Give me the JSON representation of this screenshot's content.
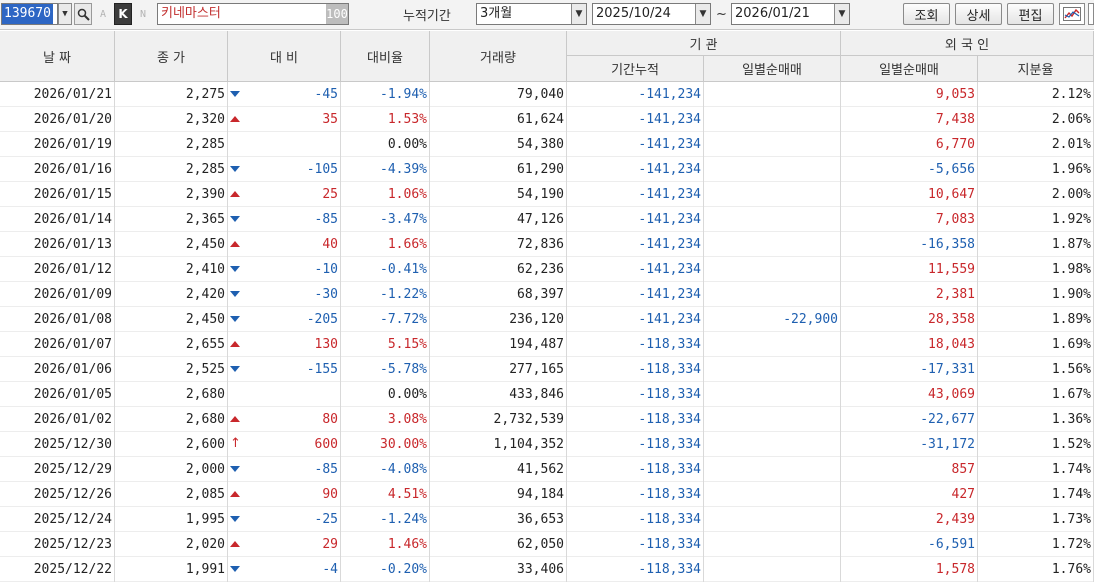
{
  "toolbar": {
    "stock_code": "139670",
    "a_label": "A",
    "k_label": "K",
    "n_label": "N",
    "stock_name": "키네마스터",
    "name_badge": "100",
    "period_label": "누적기간",
    "period_value": "3개월",
    "start_date": "2025/10/24",
    "tilde": "~",
    "end_date": "2026/01/21",
    "search_btn": "조회",
    "detail_btn": "상세",
    "edit_btn": "편집"
  },
  "headers": {
    "date": "날 짜",
    "close": "종 가",
    "change": "대 비",
    "change_rate": "대비율",
    "volume": "거래량",
    "institution": "기  관",
    "inst_cum": "기간누적",
    "inst_daily": "일별순매매",
    "foreign": "외 국 인",
    "for_daily": "일별순매매",
    "for_share": "지분율"
  },
  "rows": [
    {
      "date": "2026/01/21",
      "close": "2,275",
      "dir": "dn",
      "change": "-45",
      "rate": "-1.94%",
      "volume": "79,040",
      "inst_cum": "-141,234",
      "inst_daily": "",
      "for_daily": "9,053",
      "for_share": "2.12%"
    },
    {
      "date": "2026/01/20",
      "close": "2,320",
      "dir": "up",
      "change": "35",
      "rate": "1.53%",
      "volume": "61,624",
      "inst_cum": "-141,234",
      "inst_daily": "",
      "for_daily": "7,438",
      "for_share": "2.06%"
    },
    {
      "date": "2026/01/19",
      "close": "2,285",
      "dir": "nu",
      "change": "",
      "rate": "0.00%",
      "volume": "54,380",
      "inst_cum": "-141,234",
      "inst_daily": "",
      "for_daily": "6,770",
      "for_share": "2.01%"
    },
    {
      "date": "2026/01/16",
      "close": "2,285",
      "dir": "dn",
      "change": "-105",
      "rate": "-4.39%",
      "volume": "61,290",
      "inst_cum": "-141,234",
      "inst_daily": "",
      "for_daily": "-5,656",
      "for_share": "1.96%"
    },
    {
      "date": "2026/01/15",
      "close": "2,390",
      "dir": "up",
      "change": "25",
      "rate": "1.06%",
      "volume": "54,190",
      "inst_cum": "-141,234",
      "inst_daily": "",
      "for_daily": "10,647",
      "for_share": "2.00%"
    },
    {
      "date": "2026/01/14",
      "close": "2,365",
      "dir": "dn",
      "change": "-85",
      "rate": "-3.47%",
      "volume": "47,126",
      "inst_cum": "-141,234",
      "inst_daily": "",
      "for_daily": "7,083",
      "for_share": "1.92%"
    },
    {
      "date": "2026/01/13",
      "close": "2,450",
      "dir": "up",
      "change": "40",
      "rate": "1.66%",
      "volume": "72,836",
      "inst_cum": "-141,234",
      "inst_daily": "",
      "for_daily": "-16,358",
      "for_share": "1.87%"
    },
    {
      "date": "2026/01/12",
      "close": "2,410",
      "dir": "dn",
      "change": "-10",
      "rate": "-0.41%",
      "volume": "62,236",
      "inst_cum": "-141,234",
      "inst_daily": "",
      "for_daily": "11,559",
      "for_share": "1.98%"
    },
    {
      "date": "2026/01/09",
      "close": "2,420",
      "dir": "dn",
      "change": "-30",
      "rate": "-1.22%",
      "volume": "68,397",
      "inst_cum": "-141,234",
      "inst_daily": "",
      "for_daily": "2,381",
      "for_share": "1.90%"
    },
    {
      "date": "2026/01/08",
      "close": "2,450",
      "dir": "dn",
      "change": "-205",
      "rate": "-7.72%",
      "volume": "236,120",
      "inst_cum": "-141,234",
      "inst_daily": "-22,900",
      "for_daily": "28,358",
      "for_share": "1.89%"
    },
    {
      "date": "2026/01/07",
      "close": "2,655",
      "dir": "up",
      "change": "130",
      "rate": "5.15%",
      "volume": "194,487",
      "inst_cum": "-118,334",
      "inst_daily": "",
      "for_daily": "18,043",
      "for_share": "1.69%"
    },
    {
      "date": "2026/01/06",
      "close": "2,525",
      "dir": "dn",
      "change": "-155",
      "rate": "-5.78%",
      "volume": "277,165",
      "inst_cum": "-118,334",
      "inst_daily": "",
      "for_daily": "-17,331",
      "for_share": "1.56%"
    },
    {
      "date": "2026/01/05",
      "close": "2,680",
      "dir": "nu",
      "change": "",
      "rate": "0.00%",
      "volume": "433,846",
      "inst_cum": "-118,334",
      "inst_daily": "",
      "for_daily": "43,069",
      "for_share": "1.67%"
    },
    {
      "date": "2026/01/02",
      "close": "2,680",
      "dir": "up",
      "change": "80",
      "rate": "3.08%",
      "volume": "2,732,539",
      "inst_cum": "-118,334",
      "inst_daily": "",
      "for_daily": "-22,677",
      "for_share": "1.36%"
    },
    {
      "date": "2025/12/30",
      "close": "2,600",
      "dir": "limit",
      "change": "600",
      "rate": "30.00%",
      "volume": "1,104,352",
      "inst_cum": "-118,334",
      "inst_daily": "",
      "for_daily": "-31,172",
      "for_share": "1.52%"
    },
    {
      "date": "2025/12/29",
      "close": "2,000",
      "dir": "dn",
      "change": "-85",
      "rate": "-4.08%",
      "volume": "41,562",
      "inst_cum": "-118,334",
      "inst_daily": "",
      "for_daily": "857",
      "for_share": "1.74%"
    },
    {
      "date": "2025/12/26",
      "close": "2,085",
      "dir": "up",
      "change": "90",
      "rate": "4.51%",
      "volume": "94,184",
      "inst_cum": "-118,334",
      "inst_daily": "",
      "for_daily": "427",
      "for_share": "1.74%"
    },
    {
      "date": "2025/12/24",
      "close": "1,995",
      "dir": "dn",
      "change": "-25",
      "rate": "-1.24%",
      "volume": "36,653",
      "inst_cum": "-118,334",
      "inst_daily": "",
      "for_daily": "2,439",
      "for_share": "1.73%"
    },
    {
      "date": "2025/12/23",
      "close": "2,020",
      "dir": "up",
      "change": "29",
      "rate": "1.46%",
      "volume": "62,050",
      "inst_cum": "-118,334",
      "inst_daily": "",
      "for_daily": "-6,591",
      "for_share": "1.72%"
    },
    {
      "date": "2025/12/22",
      "close": "1,991",
      "dir": "dn",
      "change": "-4",
      "rate": "-0.20%",
      "volume": "33,406",
      "inst_cum": "-118,334",
      "inst_daily": "",
      "for_daily": "1,578",
      "for_share": "1.76%"
    }
  ],
  "colors": {
    "up": "#c8272b",
    "down": "#1e5fb0",
    "header_bg": "#f0f0f0",
    "select": "#2d66c4"
  },
  "icons": {
    "magnifier": "search-icon",
    "chart": "chart-icon",
    "dropdown": "chevron-down-icon"
  }
}
